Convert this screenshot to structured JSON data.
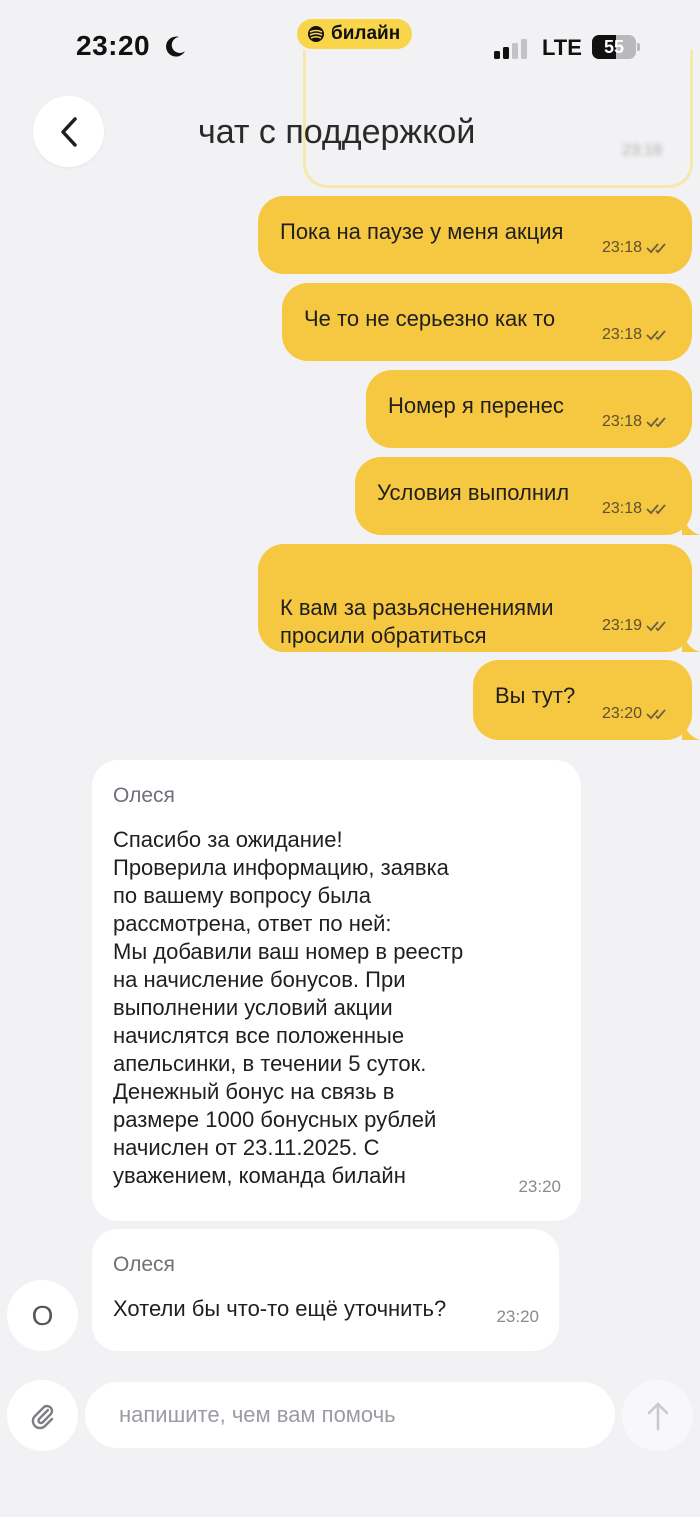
{
  "status_bar": {
    "time": "23:20",
    "carrier": "билайн",
    "network": "LTE",
    "battery_label": "55",
    "battery_level": 0.55
  },
  "header": {
    "title": "чат с поддержкой",
    "ghost_time": "23:18"
  },
  "messages_out": [
    {
      "text": "Пока на паузе у меня акция",
      "time": "23:18"
    },
    {
      "text": "Че то не серьезно как то",
      "time": "23:18"
    },
    {
      "text": "Номер я перенес",
      "time": "23:18"
    },
    {
      "text": "Условия выполнил",
      "time": "23:18"
    },
    {
      "text": "К вам за разьясненениями\nпросили обратиться",
      "time": "23:19"
    },
    {
      "text": "Вы тут?",
      "time": "23:20"
    }
  ],
  "messages_in": [
    {
      "sender": "Олеся",
      "text": "Спасибо за ожидание!\nПроверила информацию, заявка\nпо вашему вопросу была\nрассмотрена, ответ по ней:\nМы добавили ваш номер в реестр\nна начисление бонусов. При\nвыполнении условий акции\nначислятся все положенные\nапельсинки, в течении 5 суток.\nДенежный бонус на связь в\nразмере 1000 бонусных рублей\nначислен от 23.11.2025.  С\nуважением, команда билайн",
      "time": "23:20"
    },
    {
      "sender": "Олеся",
      "text": "Хотели бы что-то ещё уточнить?",
      "time": "23:20"
    }
  ],
  "agent_avatar_initial": "О",
  "composer": {
    "placeholder": "напишите, чем вам помочь"
  },
  "colors": {
    "accent_yellow": "#f6c740",
    "background": "#f2f2f4",
    "incoming_bubble": "#ffffff"
  }
}
